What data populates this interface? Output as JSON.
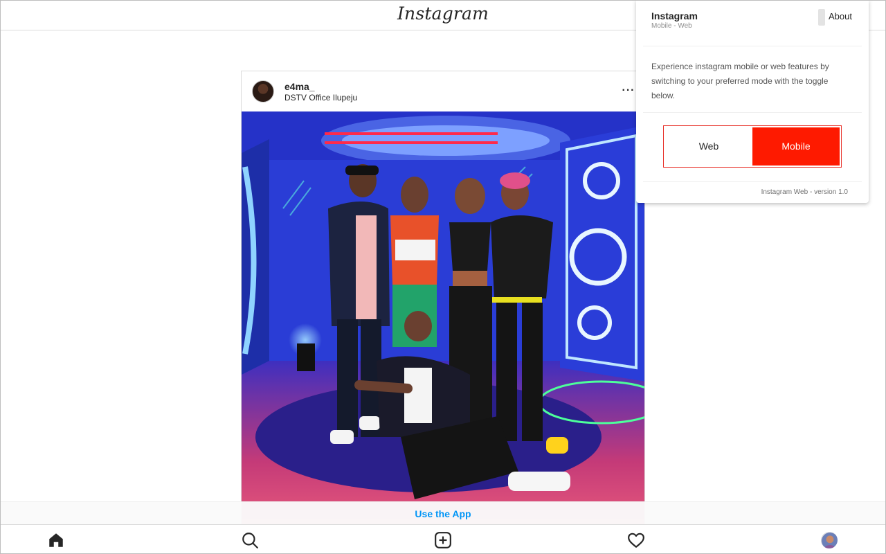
{
  "header": {
    "logo_text": "Instagram"
  },
  "post": {
    "username": "e4ma_",
    "location": "DSTV Office Ilupeju",
    "more_label": "···"
  },
  "banner": {
    "use_app_label": "Use the App"
  },
  "bottom_nav": {
    "items": [
      "home-icon",
      "search-icon",
      "new-post-icon",
      "activity-heart-icon",
      "profile-avatar"
    ]
  },
  "popup": {
    "title": "Instagram",
    "subtitle": "Mobile - Web",
    "about_label": "About",
    "description": "Experience instagram mobile or web features by switching to your preferred mode with the toggle below.",
    "toggle_web_label": "Web",
    "toggle_mobile_label": "Mobile",
    "active_mode": "Mobile",
    "version_text": "Instagram Web - version 1.0"
  },
  "colors": {
    "accent_red": "#fe1a00",
    "link_blue": "#0095f6",
    "text_dark": "#262626"
  }
}
